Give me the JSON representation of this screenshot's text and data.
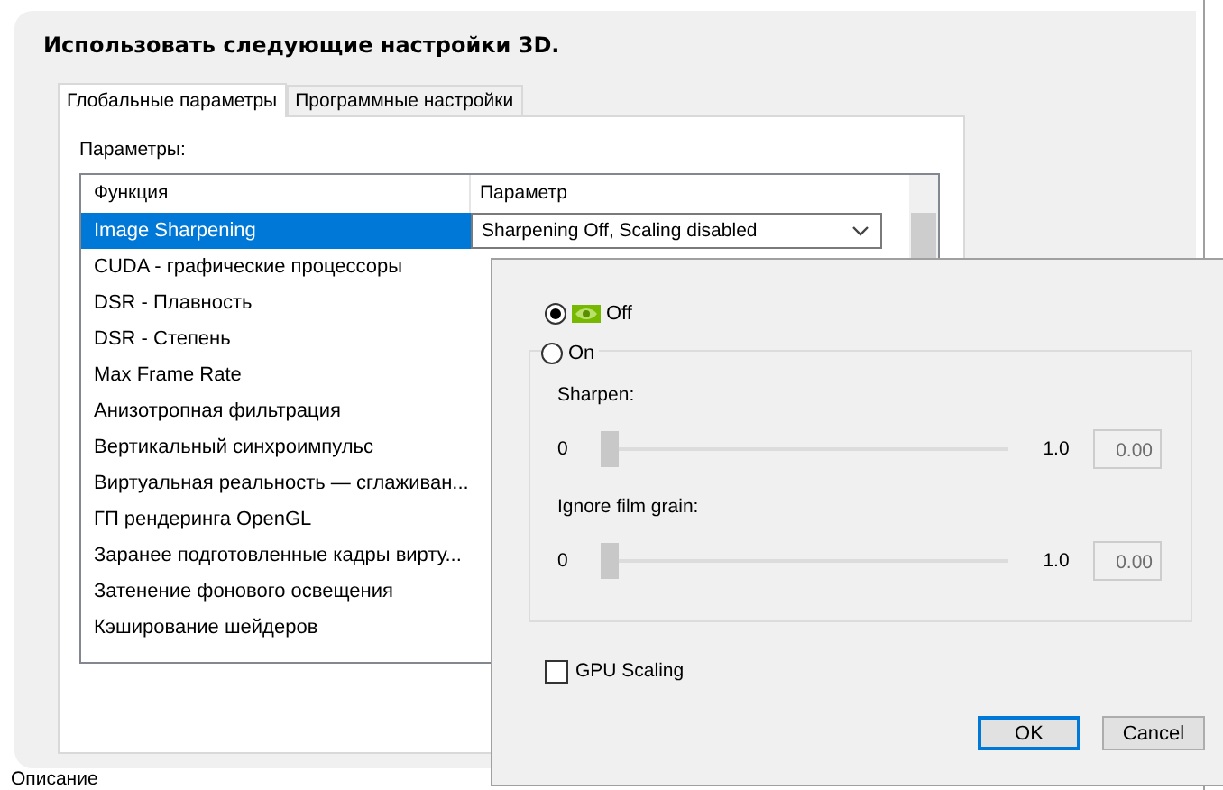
{
  "heading": "Использовать следующие настройки 3D.",
  "tabs": [
    {
      "label": "Глобальные параметры",
      "selected": true
    },
    {
      "label": "Программные настройки",
      "selected": false
    }
  ],
  "params_label": "Параметры:",
  "table": {
    "columns": [
      "Функция",
      "Параметр"
    ],
    "rows": [
      {
        "function": "Image Sharpening",
        "value": "Sharpening Off, Scaling disabled",
        "selected": true
      },
      {
        "function": "CUDA - графические процессоры",
        "selected": false
      },
      {
        "function": "DSR - Плавность",
        "selected": false
      },
      {
        "function": "DSR - Степень",
        "selected": false
      },
      {
        "function": "Max Frame Rate",
        "selected": false
      },
      {
        "function": "Анизотропная фильтрация",
        "selected": false
      },
      {
        "function": "Вертикальный синхроимпульс",
        "selected": false
      },
      {
        "function": "Виртуальная реальность — сглаживан...",
        "selected": false
      },
      {
        "function": "ГП рендеринга OpenGL",
        "selected": false
      },
      {
        "function": "Заранее подготовленные кадры вирту...",
        "selected": false
      },
      {
        "function": "Затенение фонового освещения",
        "selected": false
      },
      {
        "function": "Кэширование шейдеров",
        "selected": false
      }
    ]
  },
  "description_label": "Описание",
  "popup": {
    "radios": [
      {
        "label": "Off",
        "selected": true
      },
      {
        "label": "On",
        "selected": false
      }
    ],
    "sliders": [
      {
        "label": "Sharpen:",
        "min": "0",
        "max": "1.0",
        "level": 0,
        "value": "0.00"
      },
      {
        "label": "Ignore film grain:",
        "min": "0",
        "max": "1.0",
        "level": 0,
        "value": "0.00"
      }
    ],
    "gpu_scaling": {
      "label": "GPU Scaling",
      "checked": false
    },
    "buttons": [
      "OK",
      "Cancel"
    ]
  }
}
